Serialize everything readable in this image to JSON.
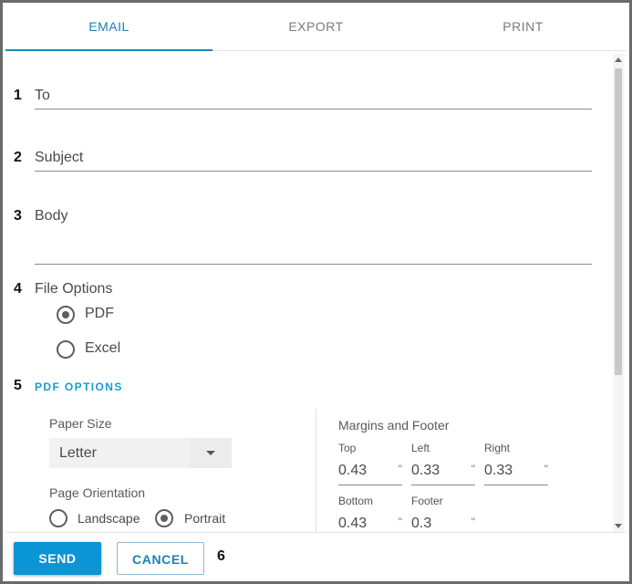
{
  "tabs": [
    {
      "label": "EMAIL",
      "active": true
    },
    {
      "label": "EXPORT",
      "active": false
    },
    {
      "label": "PRINT",
      "active": false
    }
  ],
  "step_numbers": [
    "1",
    "2",
    "3",
    "4",
    "5",
    "6"
  ],
  "fields": {
    "to_label": "To",
    "subject_label": "Subject",
    "body_label": "Body"
  },
  "file_options": {
    "label": "File Options",
    "options": [
      {
        "label": "PDF",
        "selected": true
      },
      {
        "label": "Excel",
        "selected": false
      }
    ]
  },
  "pdf_options": {
    "title": "PDF OPTIONS",
    "paper_size_label": "Paper Size",
    "paper_size_value": "Letter",
    "orientation_label": "Page Orientation",
    "orientations": [
      {
        "label": "Landscape",
        "selected": false
      },
      {
        "label": "Portrait",
        "selected": true
      }
    ],
    "margins": {
      "title": "Margins and Footer",
      "unit": "\"",
      "top": {
        "label": "Top",
        "value": "0.43"
      },
      "left": {
        "label": "Left",
        "value": "0.33"
      },
      "right": {
        "label": "Right",
        "value": "0.33"
      },
      "bottom": {
        "label": "Bottom",
        "value": "0.43"
      },
      "footer": {
        "label": "Footer",
        "value": "0.3"
      }
    }
  },
  "footer": {
    "send_label": "SEND",
    "cancel_label": "CANCEL"
  },
  "colors": {
    "accent": "#1a86c5",
    "send_button": "#0a95d6",
    "section_title": "#1a9ad4"
  }
}
